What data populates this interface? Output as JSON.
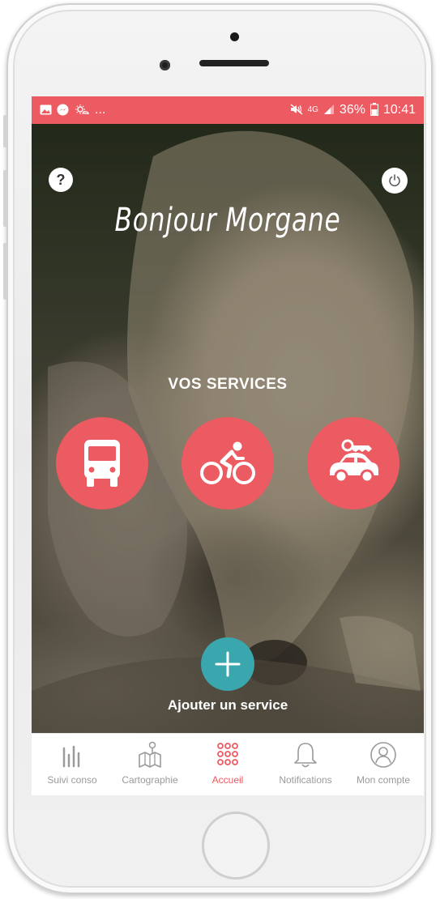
{
  "status_bar": {
    "left_more": "...",
    "network": "4G",
    "battery": "36%",
    "time": "10:41"
  },
  "header": {
    "greeting": "Bonjour Morgane"
  },
  "services": {
    "title": "VOS SERVICES",
    "items": [
      {
        "icon": "bus-icon"
      },
      {
        "icon": "bike-icon"
      },
      {
        "icon": "car-rental-icon"
      }
    ],
    "add_label": "Ajouter un service"
  },
  "tabbar": {
    "items": [
      {
        "label": "Suivi conso",
        "icon": "chart-bars-icon",
        "active": false
      },
      {
        "label": "Cartographie",
        "icon": "map-icon",
        "active": false
      },
      {
        "label": "Accueil",
        "icon": "grid-dots-icon",
        "active": true
      },
      {
        "label": "Notifications",
        "icon": "bell-icon",
        "active": false
      },
      {
        "label": "Mon compte",
        "icon": "user-icon",
        "active": false
      }
    ]
  },
  "colors": {
    "accent": "#ec5a62",
    "add_button": "#3aa6ad",
    "tab_inactive": "#9a9a9a"
  }
}
